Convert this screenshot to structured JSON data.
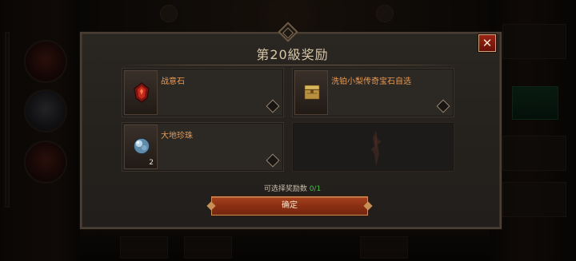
{
  "dialog": {
    "title": "第20級奖励",
    "close_icon": "close-icon",
    "rewards": [
      {
        "name": "战意石",
        "icon": "red-gem-icon",
        "count": ""
      },
      {
        "name": "洗铂小梨传奇宝石自选",
        "icon": "treasure-chest-icon",
        "count": ""
      },
      {
        "name": "大地珍珠",
        "icon": "blue-pearl-icon",
        "count": "2"
      }
    ],
    "empty_slot_icon": "emblem-placeholder-icon",
    "choice_label": "可选择奖励数",
    "choice_count": "0/1",
    "confirm_label": "确定"
  },
  "colors": {
    "reward_name": "#e79a54",
    "choice_count": "#4fbf4a",
    "close_button": "#9a2414",
    "confirm_button": "#8a2f12"
  }
}
